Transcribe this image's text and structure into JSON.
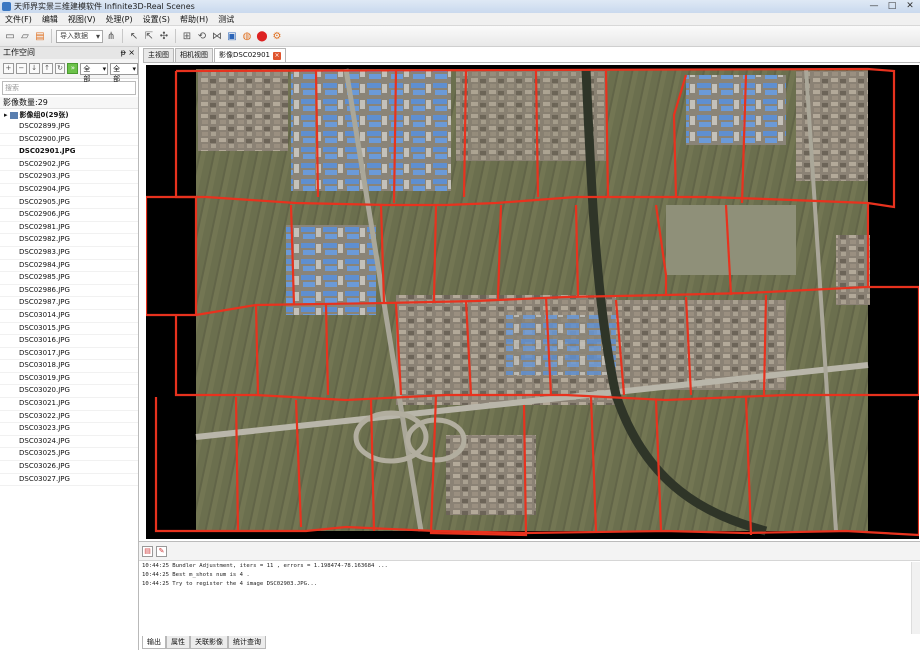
{
  "window": {
    "title": "天师界实景三维建模软件 Infinite3D-Real Scenes",
    "minimize": "—",
    "maximize": "□",
    "close": "✕"
  },
  "menu": [
    "文件(F)",
    "编辑",
    "视图(V)",
    "处理(P)",
    "设置(S)",
    "帮助(H)",
    "测试"
  ],
  "toolbar": {
    "import_combo": "导入数据"
  },
  "workspace": {
    "title": "工作空间",
    "pin": "ᵽ",
    "close": "×",
    "filter_all": "全部",
    "filter_all2": "全部",
    "search_placeholder": "搜索",
    "image_count": "影像数量:29",
    "group_label": "影像组0(29张)",
    "images": [
      "DSC02899.JPG",
      "DSC02900.JPG",
      "DSC02901.JPG",
      "DSC02902.JPG",
      "DSC02903.JPG",
      "DSC02904.JPG",
      "DSC02905.JPG",
      "DSC02906.JPG",
      "DSC02981.JPG",
      "DSC02982.JPG",
      "DSC02983.JPG",
      "DSC02984.JPG",
      "DSC02985.JPG",
      "DSC02986.JPG",
      "DSC02987.JPG",
      "DSC03014.JPG",
      "DSC03015.JPG",
      "DSC03016.JPG",
      "DSC03017.JPG",
      "DSC03018.JPG",
      "DSC03019.JPG",
      "DSC03020.JPG",
      "DSC03021.JPG",
      "DSC03022.JPG",
      "DSC03023.JPG",
      "DSC03024.JPG",
      "DSC03025.JPG",
      "DSC03026.JPG",
      "DSC03027.JPG"
    ],
    "active_image": "DSC02901.JPG"
  },
  "tabs": [
    {
      "label": "主视图"
    },
    {
      "label": "相机视图"
    },
    {
      "label": "影像DSC02901"
    }
  ],
  "log_lines": [
    "10:44:25 Bundler Adjustment, iters = 11 , errors = 1.198474-78.163684 ...",
    "10:44:25 Best m_shots num is 4 .",
    "10:44:25 Try to register the 4 image DSC02903.JPG..."
  ],
  "output_tabs": [
    "输出",
    "属性",
    "关联影像",
    "统计查询"
  ],
  "colors": {
    "seamline": "#e8321e",
    "background": "#000000",
    "accent": "#3a77c2"
  }
}
